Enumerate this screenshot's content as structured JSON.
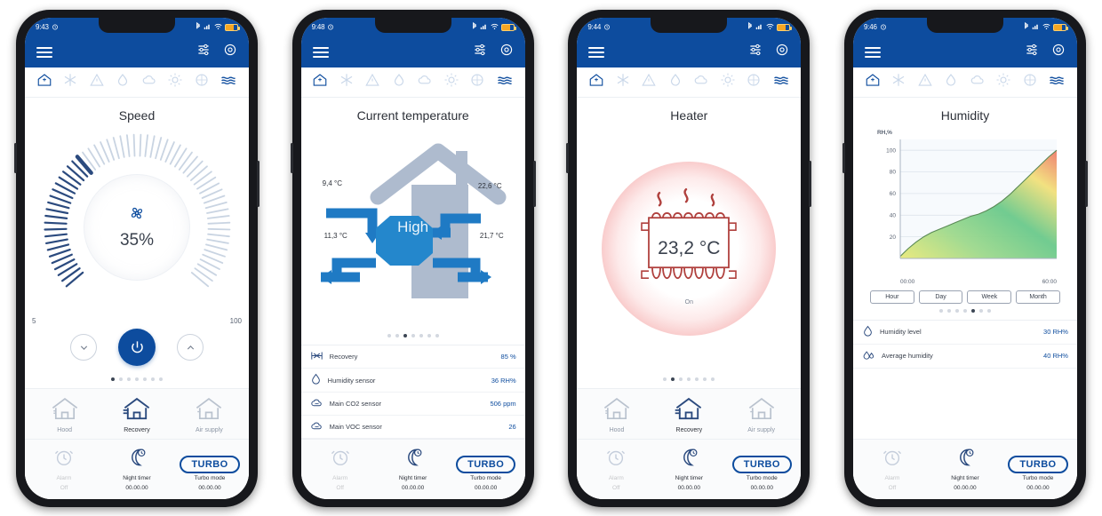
{
  "common": {
    "appbar": {
      "menu_icon": "hamburger-menu-icon",
      "sliders_icon": "sliders-icon",
      "gear_icon": "gear-icon"
    },
    "strip_icons": [
      {
        "name": "home-icon",
        "active": true
      },
      {
        "name": "snowflake-icon",
        "active": false
      },
      {
        "name": "warning-triangle-icon",
        "active": false
      },
      {
        "name": "humidity-drop-icon",
        "active": false
      },
      {
        "name": "co2-cloud-icon",
        "active": false
      },
      {
        "name": "heat-sun-icon",
        "active": false
      },
      {
        "name": "filter-icon",
        "active": false
      },
      {
        "name": "airflow-waves-icon",
        "active": true
      }
    ],
    "modes": [
      {
        "label": "Hood",
        "icon": "house-hood-icon",
        "active": false
      },
      {
        "label": "Recovery",
        "icon": "house-recovery-icon",
        "active": true
      },
      {
        "label": "Air supply",
        "icon": "house-air-supply-icon",
        "active": false
      }
    ],
    "functions": [
      {
        "label": "Alarm",
        "value": "Off",
        "icon": "alarm-clock-icon",
        "dim": true
      },
      {
        "label": "Night timer",
        "value": "00.00.00",
        "icon": "moon-clock-icon",
        "dim": false
      },
      {
        "label": "Turbo mode",
        "value": "00.00.00",
        "icon": "turbo-badge",
        "badge": "TURBO",
        "dim": false
      }
    ]
  },
  "phones": [
    {
      "id": "phone-speed",
      "status": {
        "time": "9:43",
        "alarm_icon": "alarm-icon",
        "bluetooth_icon": "bluetooth-icon",
        "signal_icon": "signal-icon",
        "wifi_icon": "wifi-icon",
        "battery_icon": "battery-icon"
      },
      "title": "Speed",
      "speed": {
        "percent": "35%",
        "value": 35,
        "min_label": "5",
        "max_label": "100",
        "fan_icon": "fan-icon",
        "down_icon": "chevron-down-icon",
        "power_icon": "power-icon",
        "up_icon": "chevron-up-icon"
      },
      "dots": {
        "count": 7,
        "active": 0
      }
    },
    {
      "id": "phone-temperature",
      "status": {
        "time": "9:48",
        "alarm_icon": "alarm-icon",
        "bluetooth_icon": "bluetooth-icon",
        "signal_icon": "signal-icon",
        "wifi_icon": "wifi-icon",
        "battery_icon": "battery-icon"
      },
      "title": "Current temperature",
      "house": {
        "mode_label": "High",
        "outdoor_in": "9,4 °C",
        "indoor_extract": "22,6 °C",
        "exhaust_out": "11,3 °C",
        "supply_in": "21,7 °C"
      },
      "sensors": [
        {
          "icon": "recovery-icon",
          "name": "Recovery",
          "value": "85 %"
        },
        {
          "icon": "humidity-drop-icon",
          "name": "Humidity sensor",
          "value": "36 RH%"
        },
        {
          "icon": "co2-cloud-icon",
          "name": "Main CO2 sensor",
          "value": "506 ppm"
        },
        {
          "icon": "voc-cloud-icon",
          "name": "Main VOC sensor",
          "value": "26"
        }
      ],
      "dots": {
        "count": 7,
        "active": 2
      }
    },
    {
      "id": "phone-heater",
      "status": {
        "time": "9:44",
        "alarm_icon": "alarm-icon",
        "bluetooth_icon": "bluetooth-icon",
        "signal_icon": "signal-icon",
        "wifi_icon": "wifi-icon",
        "battery_icon": "battery-icon"
      },
      "title": "Heater",
      "heater": {
        "temperature": "23,2 °C",
        "state": "On",
        "icon": "radiator-icon"
      },
      "dots": {
        "count": 7,
        "active": 1
      }
    },
    {
      "id": "phone-humidity",
      "status": {
        "time": "9:46",
        "alarm_icon": "alarm-icon",
        "bluetooth_icon": "bluetooth-icon",
        "signal_icon": "signal-icon",
        "wifi_icon": "wifi-icon",
        "battery_icon": "battery-icon"
      },
      "title": "Humidity",
      "timeframes": [
        "Hour",
        "Day",
        "Week",
        "Month"
      ],
      "sensors": [
        {
          "icon": "humidity-drop-icon",
          "name": "Humidity level",
          "value": "30 RH%"
        },
        {
          "icon": "average-humidity-icon",
          "name": "Average humidity",
          "value": "40 RH%"
        }
      ],
      "dots": {
        "count": 7,
        "active": 4
      }
    }
  ],
  "chart_data": {
    "type": "area",
    "title": "Humidity",
    "ylabel": "RH,%",
    "xlabel": "",
    "ylim": [
      0,
      110
    ],
    "yticks": [
      20,
      40,
      60,
      80,
      100
    ],
    "xticks": [
      "00:00",
      "60:00"
    ],
    "grid": true,
    "legend": "none",
    "x": [
      0,
      5,
      10,
      15,
      20,
      25,
      30,
      35,
      40,
      45,
      50,
      55,
      60,
      65,
      70,
      75,
      80,
      85,
      90,
      95,
      100
    ],
    "values": [
      2,
      9,
      15,
      20,
      24,
      27,
      30,
      33,
      36,
      39,
      41,
      44,
      48,
      53,
      59,
      66,
      73,
      80,
      87,
      94,
      100
    ],
    "series": [
      {
        "name": "Humidity",
        "values": [
          2,
          9,
          15,
          20,
          24,
          27,
          30,
          33,
          36,
          39,
          41,
          44,
          48,
          53,
          59,
          66,
          73,
          80,
          87,
          94,
          100
        ]
      }
    ],
    "fill_colors": [
      "#e8e86a",
      "#8fd48a",
      "#57c188",
      "#f4e06a",
      "#ef7b6b"
    ]
  },
  "colors": {
    "brand_blue": "#0d4c9e",
    "accent_blue": "#1f7ac4",
    "heater_red": "#ef8686",
    "text_dark": "#2c3038",
    "muted": "#8d97a6"
  }
}
